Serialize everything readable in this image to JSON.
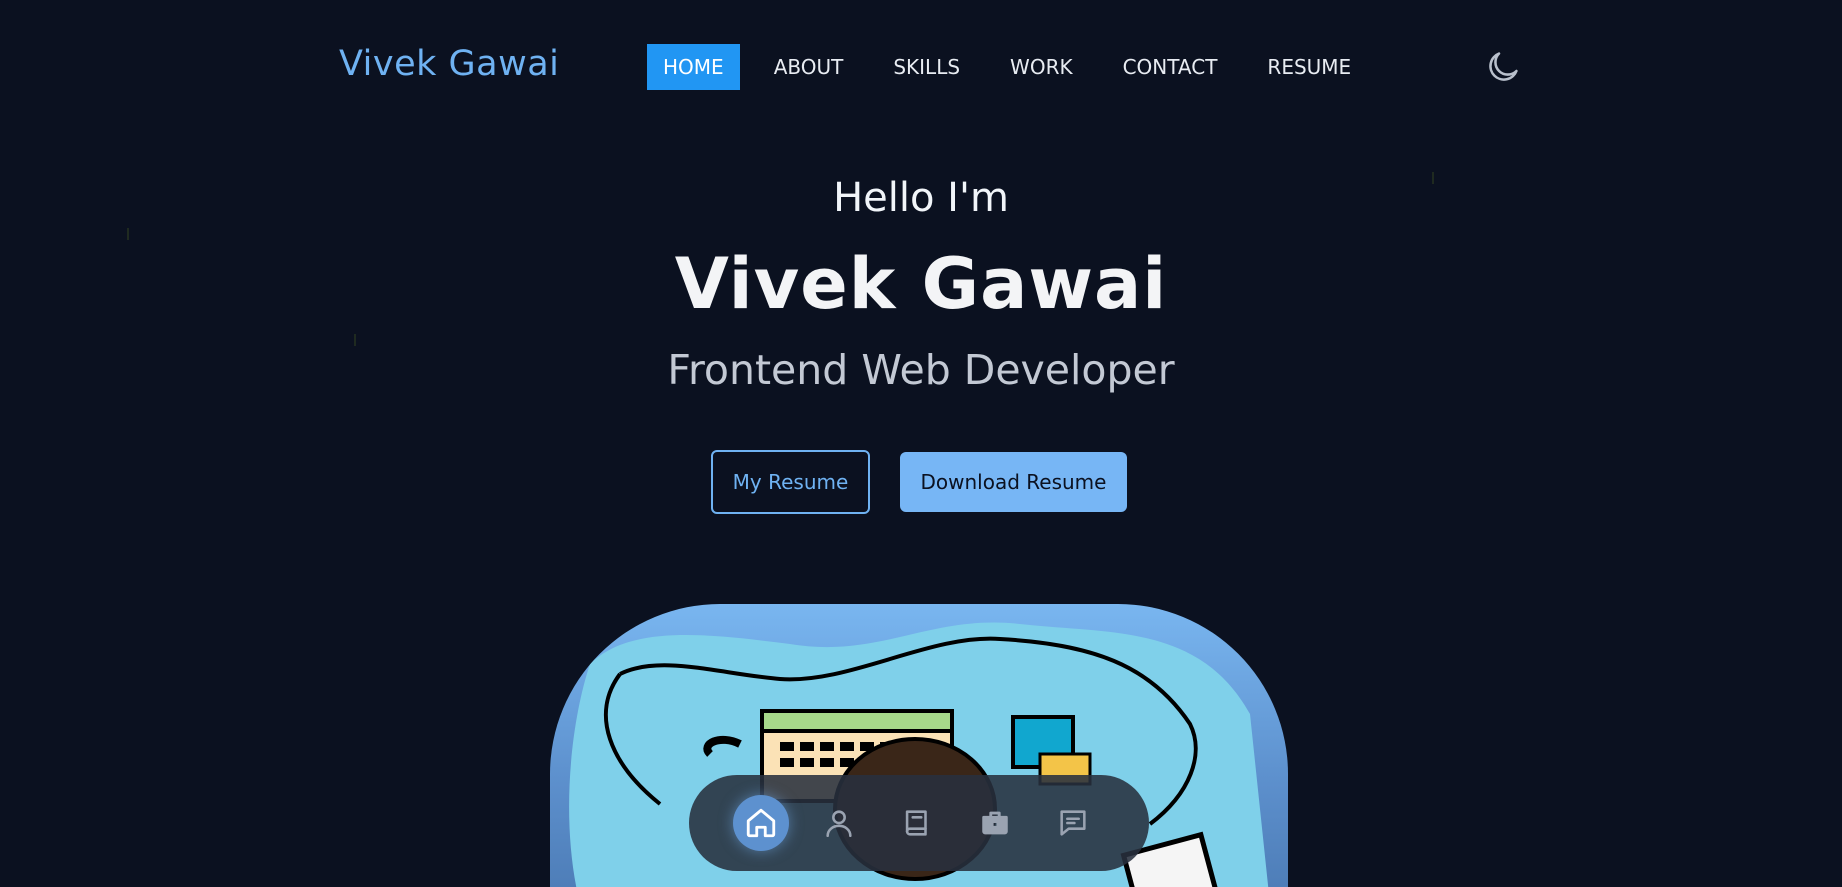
{
  "brand": {
    "logo_text": "Vivek Gawai"
  },
  "nav": {
    "items": [
      {
        "label": "HOME",
        "active": true
      },
      {
        "label": "ABOUT",
        "active": false
      },
      {
        "label": "SKILLS",
        "active": false
      },
      {
        "label": "WORK",
        "active": false
      },
      {
        "label": "CONTACT",
        "active": false
      },
      {
        "label": "RESUME",
        "active": false
      }
    ],
    "theme_toggle_icon": "moon-icon"
  },
  "hero": {
    "greeting": "Hello I'm",
    "name": "Vivek Gawai",
    "role": "Frontend Web Developer",
    "buttons": {
      "my_resume": "My Resume",
      "download_resume": "Download Resume"
    }
  },
  "dock": {
    "items": [
      {
        "icon": "home-icon",
        "active": true
      },
      {
        "icon": "user-icon",
        "active": false
      },
      {
        "icon": "book-icon",
        "active": false
      },
      {
        "icon": "briefcase-icon",
        "active": false
      },
      {
        "icon": "message-icon",
        "active": false
      }
    ]
  },
  "colors": {
    "background": "#0b1120",
    "accent": "#2196f3",
    "brand_blue": "#6fb2f2",
    "button_fill": "#77b6f5"
  }
}
